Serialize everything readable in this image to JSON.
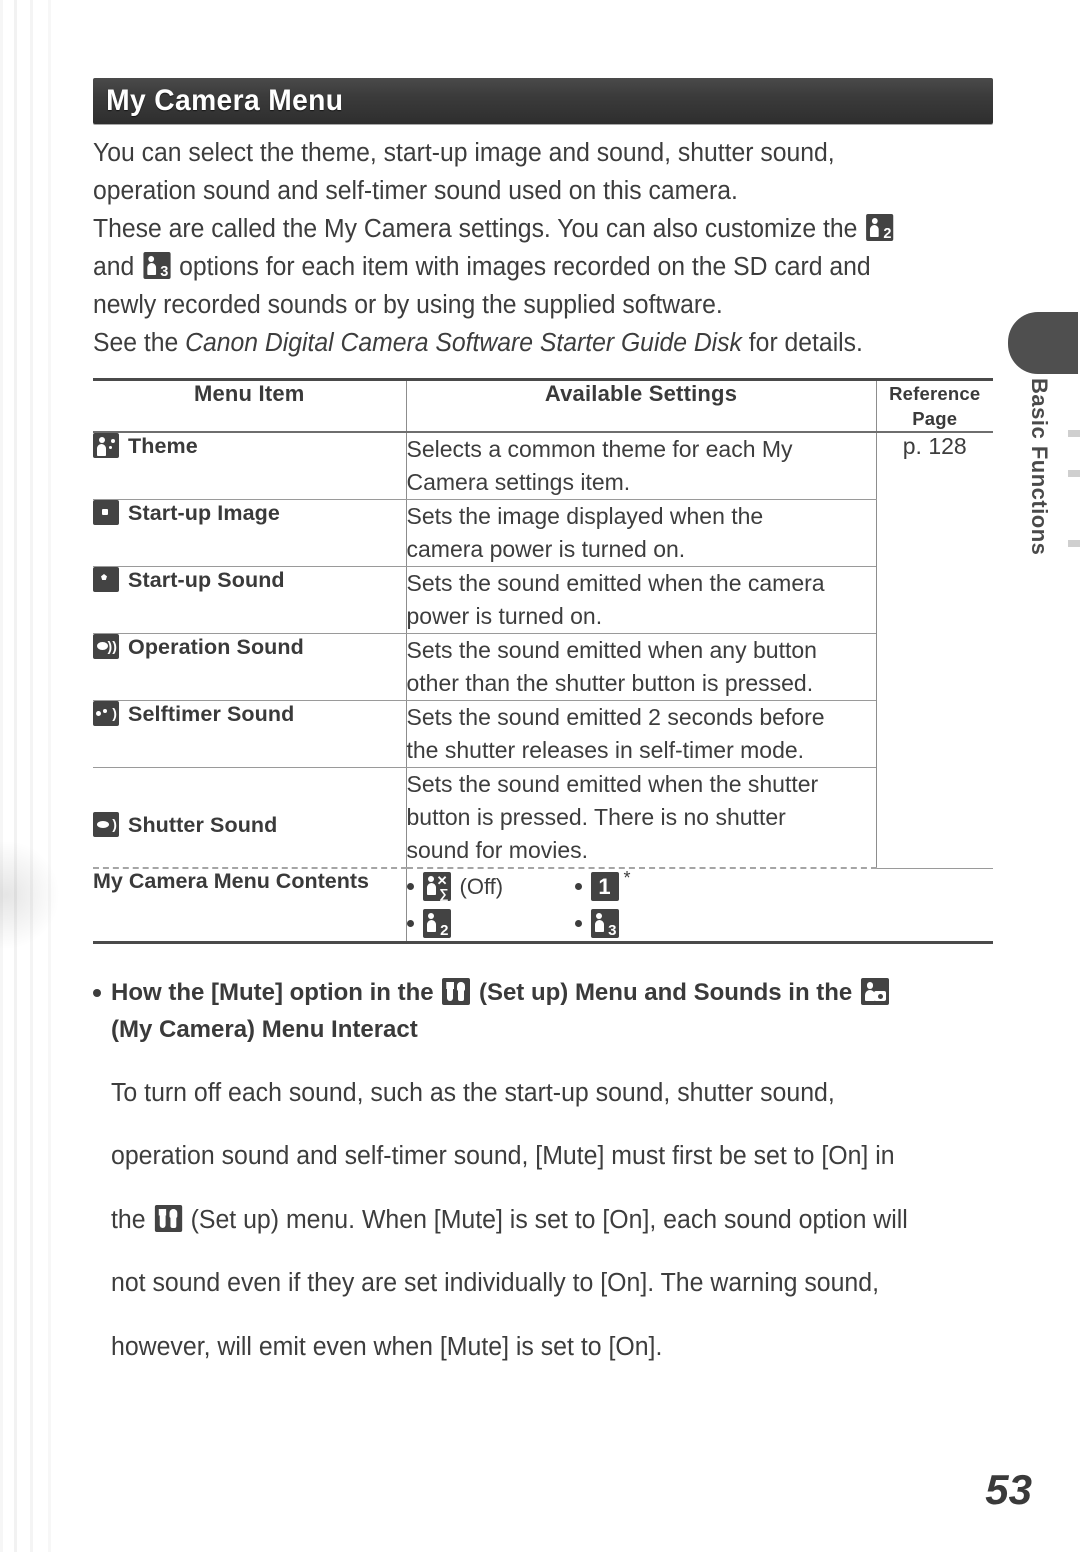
{
  "section": {
    "banner_title": "My Camera Menu"
  },
  "intro": {
    "line1": "You can select the theme, start-up image and sound, shutter sound,",
    "line2": "operation sound and self-timer sound used on this camera.",
    "line3a": "These are called the My Camera settings. You can also customize the",
    "line3b": "and",
    "line3c": "options for each item with images recorded on the SD card and",
    "line4": "newly recorded sounds or by using the supplied software.",
    "line5a": "See the",
    "line5_italic": "Canon Digital Camera Software Starter Guide Disk",
    "line5b": "for details.",
    "icon_my_camera_2": "my-camera-2-icon",
    "icon_my_camera_3": "my-camera-3-icon"
  },
  "table": {
    "headers": {
      "menu_item": "Menu Item",
      "available_settings": "Available Settings",
      "reference_page_line1": "Reference",
      "reference_page_line2": "Page"
    },
    "reference_page_value": "p. 128",
    "rows": [
      {
        "icon": "theme-icon",
        "label": "Theme",
        "setting_line1": "Selects a common theme for each My",
        "setting_line2": "Camera settings item."
      },
      {
        "icon": "start-up-image-icon",
        "label": "Start-up Image",
        "setting_line1": "Sets the image displayed when the",
        "setting_line2": "camera power is turned on."
      },
      {
        "icon": "start-up-sound-icon",
        "label": "Start-up Sound",
        "setting_line1": "Sets the sound emitted when the camera",
        "setting_line2": "power is turned on."
      },
      {
        "icon": "operation-sound-icon",
        "label": "Operation Sound",
        "setting_line1": "Sets the sound emitted when any button",
        "setting_line2": "other than the shutter button is pressed."
      },
      {
        "icon": "selftimer-sound-icon",
        "label": "Selftimer Sound",
        "setting_line1": "Sets the sound emitted 2 seconds before",
        "setting_line2": "the shutter releases in self-timer mode."
      },
      {
        "icon": "shutter-sound-icon",
        "label": "Shutter Sound",
        "setting_line1": "Sets the sound emitted when the shutter",
        "setting_line2": "button is pressed. There is no shutter",
        "setting_line3": "sound for movies."
      }
    ],
    "contents_row": {
      "label": "My Camera Menu Contents",
      "options": [
        {
          "icon": "my-camera-off-icon",
          "label": "(Off)",
          "star": ""
        },
        {
          "icon": "my-camera-1-icon",
          "label": "",
          "star": "*"
        },
        {
          "icon": "my-camera-2-icon",
          "label": "",
          "star": ""
        },
        {
          "icon": "my-camera-3-icon",
          "label": "",
          "star": ""
        }
      ]
    }
  },
  "note": {
    "heading_a": "How the [Mute] option in the",
    "heading_icon_setup": "set-up-icon",
    "heading_b": "(Set up) Menu and Sounds in the",
    "heading_icon_mycamera": "my-camera-icon",
    "heading_c": "(My Camera) Menu Interact",
    "body_line1": "To turn off each sound, such as the start-up sound, shutter sound,",
    "body_line2": "operation sound and self-timer sound, [Mute] must first be set to [On] in",
    "body_line3a": "the",
    "body_line3b": "(Set up) menu. When [Mute] is set to [On], each sound option will",
    "body_line4": "not sound even if they are set individually to [On]. The warning sound,",
    "body_line5": "however, will emit even when [Mute] is set to [On]."
  },
  "side_tab": {
    "label": "Basic Functions"
  },
  "footer": {
    "page_number": "53"
  }
}
